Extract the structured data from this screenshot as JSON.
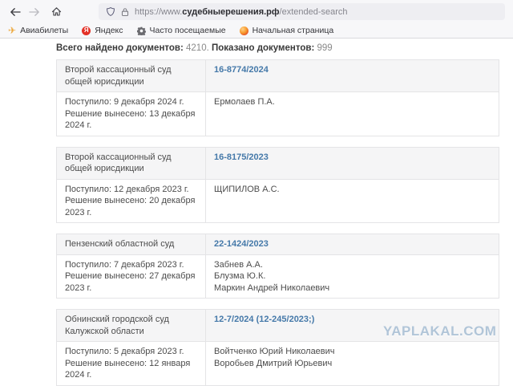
{
  "browser": {
    "url_prefix": "https://www.",
    "url_domain": "судебныерешения.рф",
    "url_path": "/extended-search",
    "bookmarks": [
      {
        "icon": "airplane-icon",
        "label": "Авиабилеты"
      },
      {
        "icon": "yandex-icon",
        "letter": "Я",
        "label": "Яндекс"
      },
      {
        "icon": "gear-icon",
        "label": "Часто посещаемые"
      },
      {
        "icon": "orange-sphere-icon",
        "label": "Начальная страница"
      }
    ]
  },
  "summary": {
    "total_label": "Всего найдено документов:",
    "total_value": "4210.",
    "shown_label": "Показано документов:",
    "shown_value": "999"
  },
  "results": [
    {
      "court": "Второй кассационный суд общей юрисдикции",
      "case_number": "16-8774/2024",
      "received": "Поступило: 9 декабря 2024 г.",
      "decided": "Решение вынесено: 13 декабря 2024 г.",
      "participants": [
        "Ермолаев П.А."
      ]
    },
    {
      "court": "Второй кассационный суд общей юрисдикции",
      "case_number": "16-8175/2023",
      "received": "Поступило: 12 декабря 2023 г.",
      "decided": "Решение вынесено: 20 декабря 2023 г.",
      "participants": [
        "ЩИПИЛОВ А.С."
      ]
    },
    {
      "court": "Пензенский областной суд",
      "case_number": "22-1424/2023",
      "received": "Поступило: 7 декабря 2023 г.",
      "decided": "Решение вынесено: 27 декабря 2023 г.",
      "participants": [
        "Забнев А.А.",
        "Блузма Ю.К.",
        "Маркин Андрей Николаевич"
      ]
    },
    {
      "court": "Обнинский городской суд Калужской области",
      "case_number": "12-7/2024 (12-245/2023;)",
      "received": "Поступило: 5 декабря 2023 г.",
      "decided": "Решение вынесено: 12 января 2024 г.",
      "participants": [
        "Войтченко Юрий Николаевич",
        "Воробьев Дмитрий Юрьевич"
      ]
    }
  ],
  "watermark": "YAPLAKAL.COM",
  "colors": {
    "link": "#4579a9",
    "header_row_bg": "#f5f5f6",
    "table_border": "#e4e4e6",
    "watermark": "#b1c5d8",
    "yandex_red": "#e33026",
    "toolbar_bg": "#f7f7f9",
    "urlbar_bg": "#eeeef2"
  }
}
